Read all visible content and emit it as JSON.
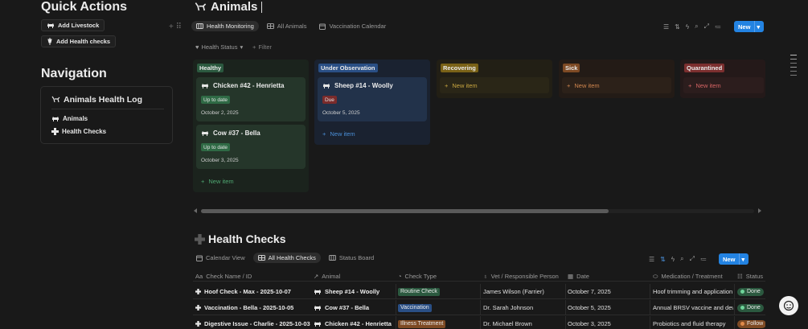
{
  "quick_actions": {
    "title": "Quick Actions",
    "add_livestock": "Add Livestock",
    "add_health_checks": "Add Health checks"
  },
  "navigation": {
    "title": "Navigation",
    "box_title": "Animals Health Log",
    "items": [
      {
        "label": "Animals",
        "icon": "cow-icon"
      },
      {
        "label": "Health Checks",
        "icon": "cross-icon"
      }
    ]
  },
  "animals": {
    "title": "Animals",
    "tabs": [
      "Health Monitoring",
      "All Animals",
      "Vaccination Calendar"
    ],
    "group_by": "Health Status",
    "filter": "Filter",
    "new_label": "New",
    "columns": [
      {
        "name": "Healthy",
        "cards": [
          {
            "title": "Chicken #42 - Henrietta",
            "badge": "Up to date",
            "date": "October 2, 2025"
          },
          {
            "title": "Cow #37 - Bella",
            "badge": "Up to date",
            "date": "October 3, 2025"
          }
        ],
        "new_item": "New item"
      },
      {
        "name": "Under Observation",
        "cards": [
          {
            "title": "Sheep #14 - Woolly",
            "badge": "Due",
            "date": "October 5, 2025"
          }
        ],
        "new_item": "New item"
      },
      {
        "name": "Recovering",
        "new_item": "New item"
      },
      {
        "name": "Sick",
        "new_item": "New item"
      },
      {
        "name": "Quarantined",
        "new_item": "New item"
      }
    ]
  },
  "health_checks": {
    "title": "Health Checks",
    "tabs": [
      "Calendar View",
      "All Health Checks",
      "Status Board"
    ],
    "new_label": "New",
    "columns": [
      "Check Name / ID",
      "Animal",
      "Check Type",
      "Vet / Responsible Person",
      "Date",
      "Medication / Treatment",
      "Status"
    ],
    "rows": [
      {
        "name": "Hoof Check - Max - 2025-10-07",
        "animal": "Sheep #14 - Woolly",
        "type": "Routine Check",
        "vet": "James Wilson (Farrier)",
        "date": "October 7, 2025",
        "med": "Hoof trimming and application",
        "status": "Done"
      },
      {
        "name": "Vaccination - Bella - 2025-10-05",
        "animal": "Cow #37 - Bella",
        "type": "Vaccination",
        "vet": "Dr. Sarah Johnson",
        "date": "October 5, 2025",
        "med": "Annual BRSV vaccine and dewo",
        "status": "Done"
      },
      {
        "name": "Digestive Issue - Charlie - 2025-10-03",
        "animal": "Chicken #42 - Henrietta",
        "type": "Illness Treatment",
        "vet": "Dr. Michael Brown",
        "date": "October 3, 2025",
        "med": "Probiotics and fluid therapy",
        "status": "Follow"
      }
    ]
  },
  "colors": {
    "accent": "#2383e2",
    "healthy_bg": "#1f2b22",
    "observation_bg": "#1d2a3a",
    "recovering_bg": "#2c2612",
    "sick_bg": "#2e1f17",
    "quarantined_bg": "#2e1a1a"
  }
}
